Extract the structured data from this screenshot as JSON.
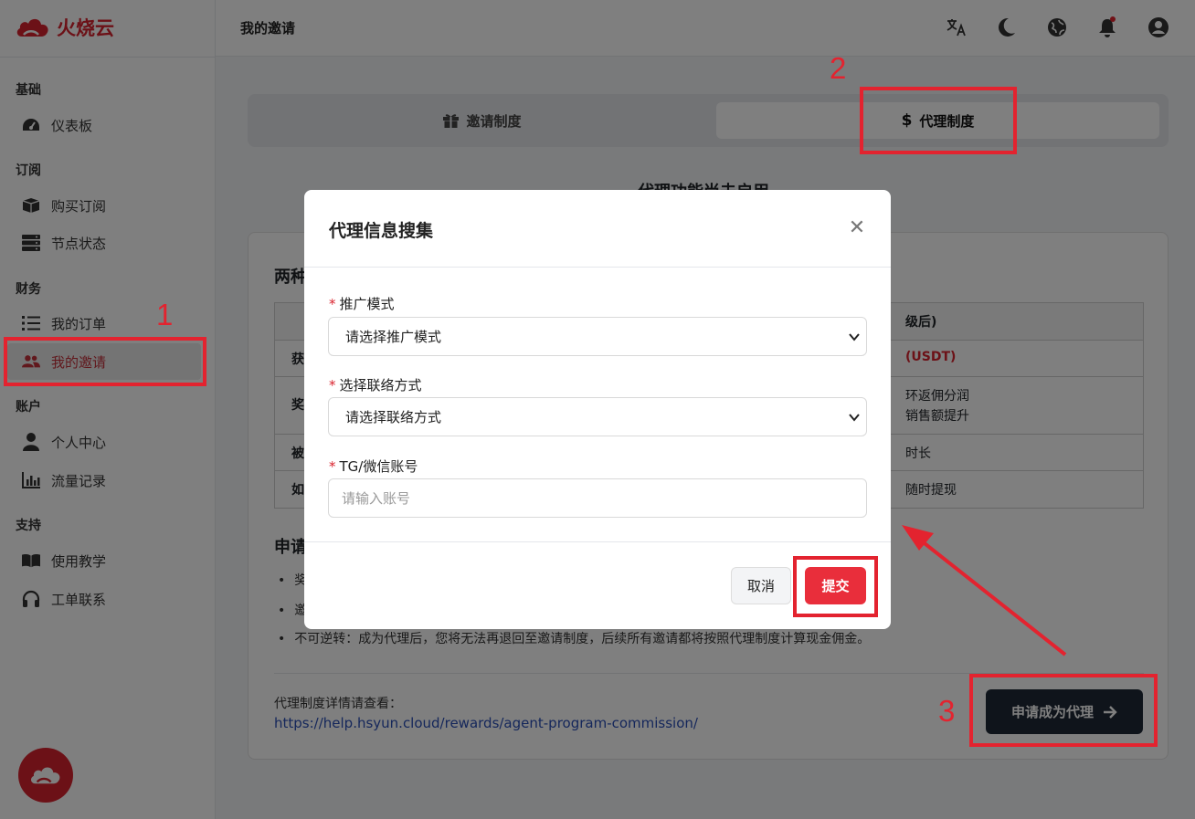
{
  "app": {
    "name": "火烧云"
  },
  "topbar": {
    "title": "我的邀请"
  },
  "sidebar": {
    "sections": [
      {
        "title": "基础",
        "items": [
          {
            "label": "仪表板",
            "icon": "gauge-icon"
          }
        ]
      },
      {
        "title": "订阅",
        "items": [
          {
            "label": "购买订阅",
            "icon": "box-icon"
          },
          {
            "label": "节点状态",
            "icon": "server-icon"
          }
        ]
      },
      {
        "title": "财务",
        "items": [
          {
            "label": "我的订单",
            "icon": "list-icon"
          },
          {
            "label": "我的邀请",
            "icon": "users-icon",
            "active": true
          }
        ]
      },
      {
        "title": "账户",
        "items": [
          {
            "label": "个人中心",
            "icon": "person-icon"
          },
          {
            "label": "流量记录",
            "icon": "bar-chart-icon"
          }
        ]
      },
      {
        "title": "支持",
        "items": [
          {
            "label": "使用教学",
            "icon": "book-icon"
          },
          {
            "label": "工单联系",
            "icon": "headset-icon"
          }
        ]
      }
    ]
  },
  "tabs": [
    {
      "label": "邀请制度",
      "icon": "gift-icon"
    },
    {
      "label": "代理制度",
      "icon": "dollar-icon",
      "active": true
    }
  ],
  "main": {
    "heading_visible": "代理功能尚未启用",
    "card_heading": "两种",
    "table_rows": [
      {
        "c1": "",
        "c3": "级后)"
      },
      {
        "c1": "获",
        "c3": "(USDT)"
      },
      {
        "c1": "奖",
        "c3": "环返佣分润",
        "c3b": "销售额提升"
      },
      {
        "c1": "被",
        "c3": "时长"
      },
      {
        "c1": "如",
        "c3": "随时提现"
      }
    ],
    "apply_heading": "申请",
    "bullets": [
      "奖",
      "邀",
      "不可逆转：成为代理后，您将无法再退回至邀请制度，后续所有邀请都将按照代理制度计算现金佣金。"
    ],
    "detail_label": "代理制度详情请查看：",
    "detail_link": "https://help.hsyun.cloud/rewards/agent-program-commission/",
    "apply_button": "申请成为代理"
  },
  "modal": {
    "title": "代理信息搜集",
    "fields": [
      {
        "label": "推广模式",
        "required": "*",
        "value": "请选择推广模式"
      },
      {
        "label": "选择联络方式",
        "required": "*",
        "value": "请选择联络方式"
      },
      {
        "label": "TG/微信账号",
        "required": "*",
        "placeholder": "请输入账号"
      }
    ],
    "cancel_label": "取消",
    "submit_label": "提交"
  },
  "annotations": {
    "n1": "1",
    "n2": "2",
    "n3": "3"
  },
  "colors": {
    "brand": "#d9232e",
    "annotation": "#e3232f",
    "dark_button": "#1f2937"
  }
}
